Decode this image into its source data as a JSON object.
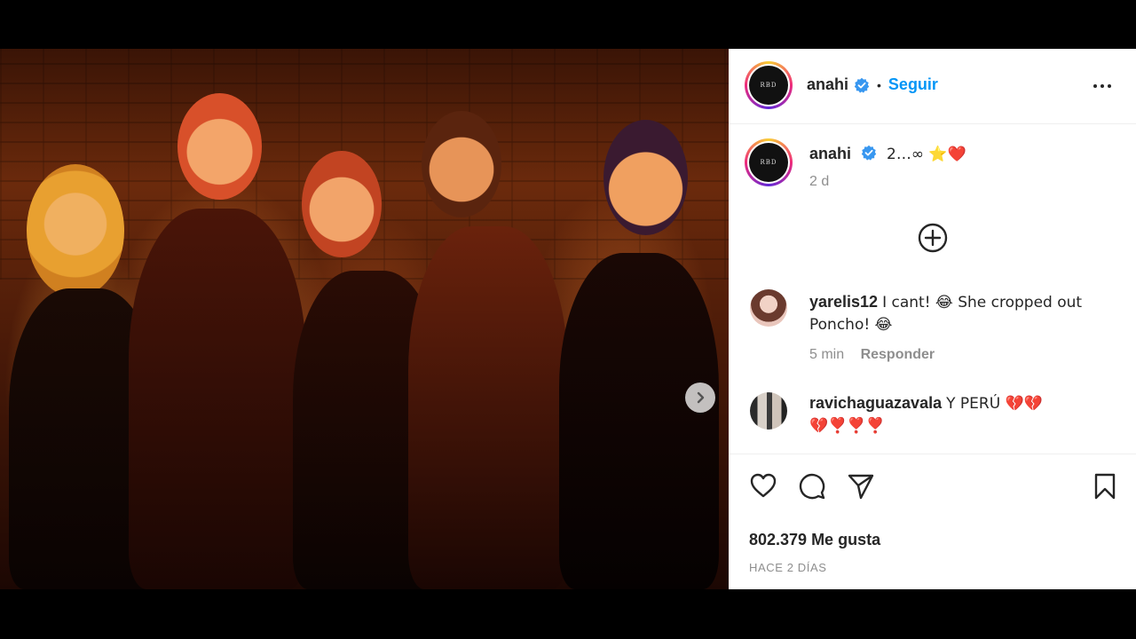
{
  "post": {
    "username": "anahi",
    "follow_label": "Seguir",
    "separator": "•",
    "avatar_text": "RBD",
    "caption": "2…∞ ⭐❤️",
    "caption_time": "2 d",
    "likes": "802.379 Me gusta",
    "posted_ago": "HACE 2 DÍAS"
  },
  "comments": [
    {
      "username": "yarelis12",
      "text": "I cant! 😂 She cropped out Poncho! 😂",
      "time": "5 min",
      "reply_label": "Responder"
    },
    {
      "username": "ravichaguazavala",
      "text": "Y PERÚ 💔💔💔❣️❣️❣️"
    }
  ],
  "icons": {
    "more": "more-horizontal-icon",
    "verified": "verified-badge-icon",
    "add": "plus-circle-icon",
    "like": "heart-icon",
    "comment": "comment-icon",
    "share": "send-icon",
    "save": "bookmark-icon",
    "next": "chevron-right-icon"
  },
  "colors": {
    "accent": "#0095f6",
    "verified": "#3897f0",
    "text": "#262626",
    "muted": "#8e8e8e"
  }
}
